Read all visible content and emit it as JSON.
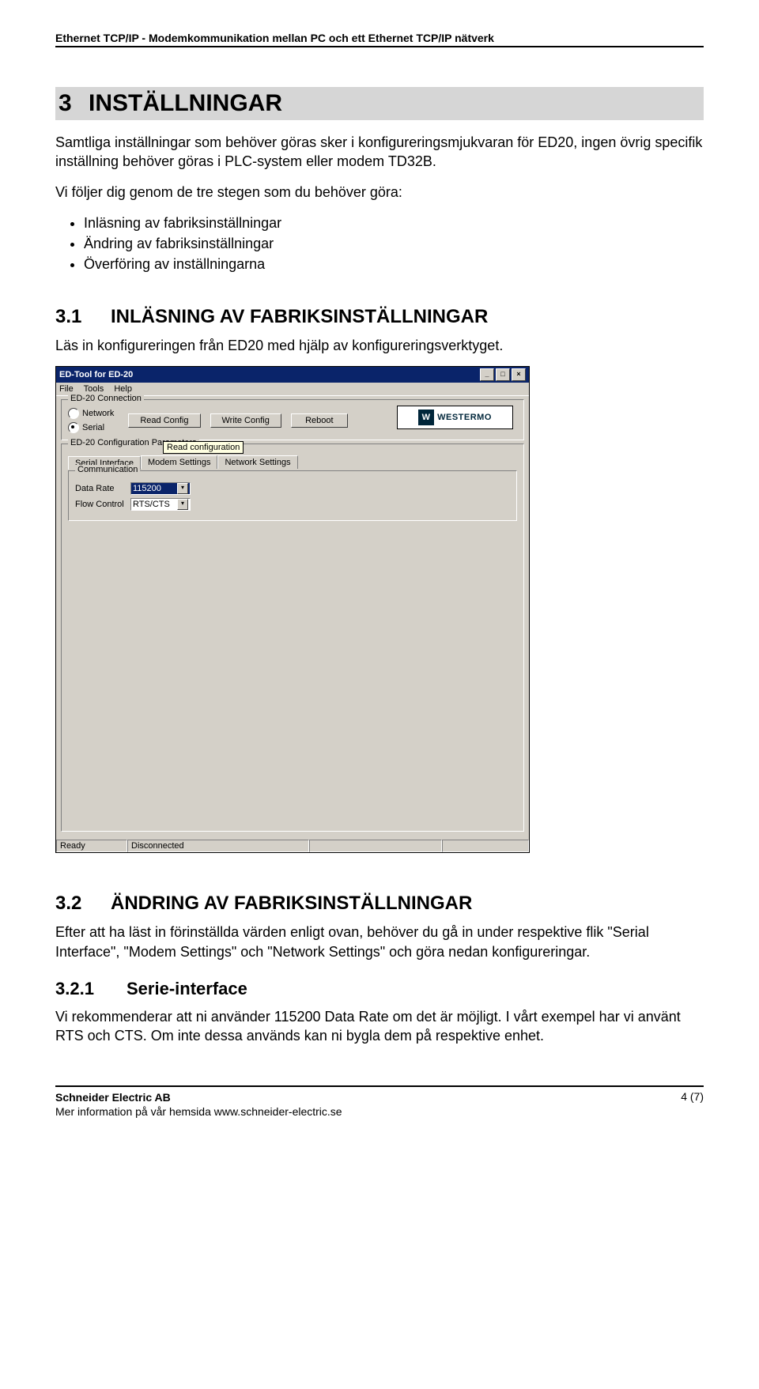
{
  "header": {
    "title": "Ethernet TCP/IP - Modemkommunikation mellan PC och ett Ethernet TCP/IP nätverk"
  },
  "section3": {
    "number": "3",
    "title": "INSTÄLLNINGAR",
    "para1": "Samtliga inställningar som behöver göras sker i konfigureringsmjukvaran för ED20, ingen övrig specifik inställning behöver göras i PLC-system eller modem TD32B.",
    "para2": "Vi följer dig genom de tre stegen som du behöver göra:",
    "bullets": [
      "Inläsning av fabriksinställningar",
      "Ändring av fabriksinställningar",
      "Överföring av inställningarna"
    ]
  },
  "section31": {
    "number": "3.1",
    "title": "INLÄSNING AV FABRIKSINSTÄLLNINGAR",
    "para": "Läs in konfigureringen från ED20 med hjälp av konfigureringsverktyget."
  },
  "edtool": {
    "window_title": "ED-Tool for ED-20",
    "menus": [
      "File",
      "Tools",
      "Help"
    ],
    "conn_group": "ED-20 Connection",
    "radio_network": "Network",
    "radio_serial": "Serial",
    "btn_read": "Read Config",
    "btn_write": "Write Config",
    "btn_reboot": "Reboot",
    "logo_text": "WESTERMO",
    "tooltip": "Read configuration",
    "config_group": "ED-20 Configuration Parameters",
    "tabs": [
      "Serial Interface",
      "Modem Settings",
      "Network Settings"
    ],
    "comm_group": "Communication",
    "data_rate_label": "Data Rate",
    "data_rate_value": "115200",
    "flow_label": "Flow Control",
    "flow_value": "RTS/CTS",
    "status_ready": "Ready",
    "status_conn": "Disconnected"
  },
  "section32": {
    "number": "3.2",
    "title": "ÄNDRING AV FABRIKSINSTÄLLNINGAR",
    "para": "Efter att ha läst in förinställda värden enligt ovan, behöver du gå in under respektive flik \"Serial Interface\", \"Modem Settings\" och \"Network Settings\" och göra nedan konfigureringar."
  },
  "section321": {
    "number": "3.2.1",
    "title": "Serie-interface",
    "para": "Vi rekommenderar att ni använder 115200 Data Rate om det är möjligt. I vårt exempel har vi använt RTS och CTS. Om inte dessa används kan ni bygla dem på respektive enhet."
  },
  "footer": {
    "company": "Schneider Electric AB",
    "line2": "Mer information på vår hemsida www.schneider-electric.se",
    "page": "4 (7)"
  }
}
